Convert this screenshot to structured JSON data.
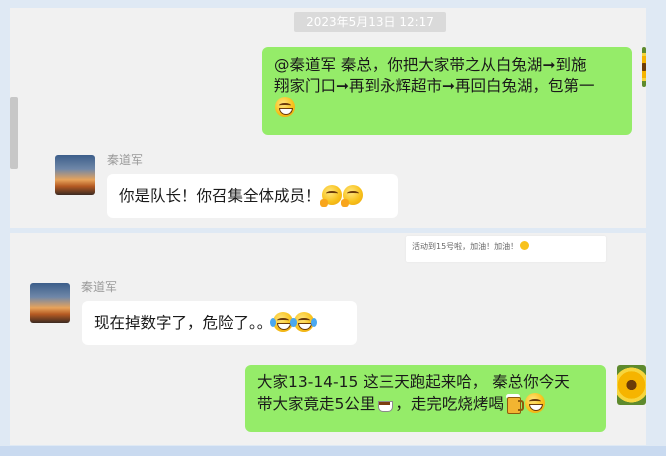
{
  "chat": {
    "timestamp": "2023年5月13日 12:17",
    "messages": [
      {
        "sender": "me",
        "text": "@秦道军 秦总，你把大家带之从白兔湖→到施翔家门口→再到永辉超市→再回白兔湖，包第一",
        "parts": [
          "@秦道军 秦总，你把大家带之从白兔湖",
          "➞",
          "到施",
          "翔家门口",
          "➞",
          "再到永辉超市",
          "➞",
          "再回白兔湖，包第一"
        ],
        "emojis": [
          "grin-icon"
        ]
      },
      {
        "sender": "秦道军",
        "text": "你是队长！你召集全体成员！",
        "emojis": [
          "thinking-face-icon",
          "thinking-face-icon"
        ]
      },
      {
        "sender": "snippet",
        "text": "活动到15号啦，加油！加油！"
      },
      {
        "sender": "秦道军",
        "text": "现在掉数字了，危险了。。",
        "emojis": [
          "laugh-cry-icon",
          "laugh-cry-icon"
        ]
      },
      {
        "sender": "me",
        "text_line1": "大家13-14-15  这三天跑起来哈， 秦总你今天",
        "text_line2a": "带大家竟走5公里",
        "text_line2b": "，走完吃烧烤喝",
        "emojis": [
          "coffee-icon",
          "beer-mug-icon",
          "grin-icon"
        ]
      }
    ]
  },
  "colors": {
    "my_bubble": "#95ec69",
    "other_bubble": "#ffffff",
    "panel_bg": "#f1f1f1",
    "page_bg": "#dfe9f4"
  }
}
